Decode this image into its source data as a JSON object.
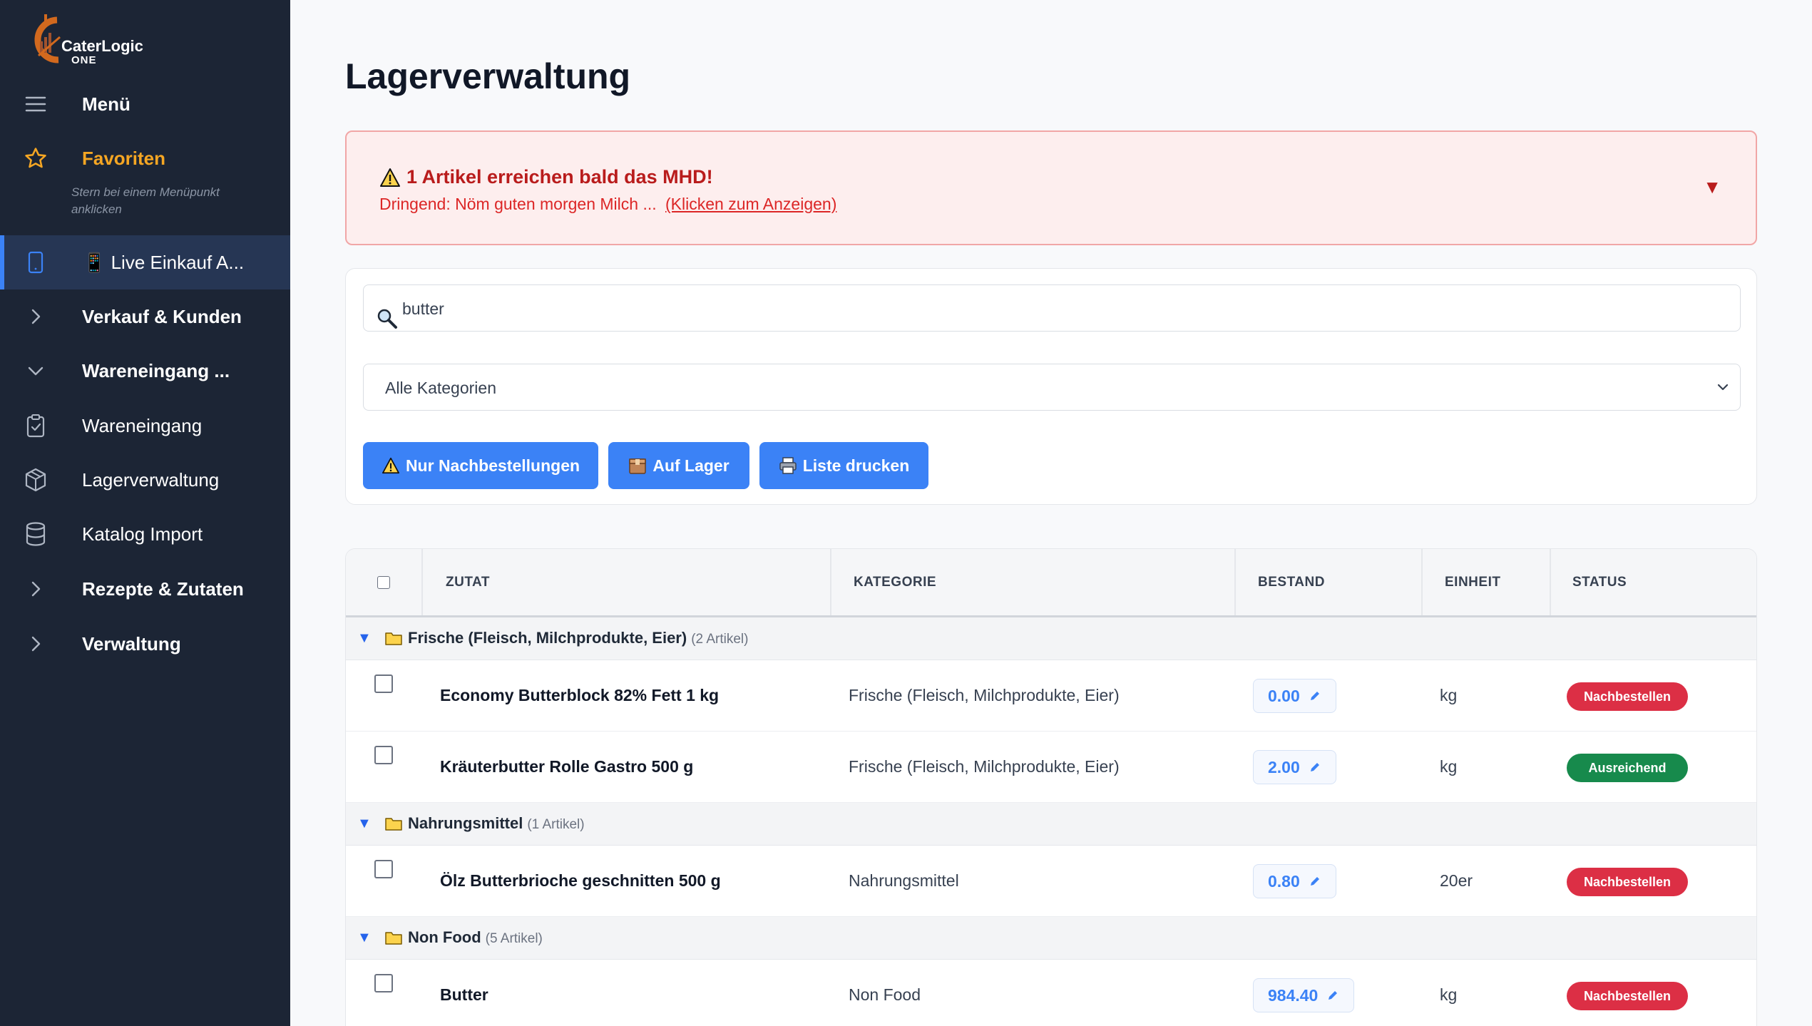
{
  "brand": {
    "logo_name": "CaterLogic",
    "logo_sub": "ONE",
    "accent_color": "#f5a623"
  },
  "sidebar": {
    "menu_label": "Menü",
    "favorites_label": "Favoriten",
    "favorites_hint": "Stern bei einem Menüpunkt anklicken",
    "items": [
      {
        "label": "📱 Live Einkauf A...",
        "icon": "mobile-icon",
        "active": true
      },
      {
        "label": "Verkauf & Kunden",
        "icon": "chevron-right-icon"
      },
      {
        "label": "Wareneingang ...",
        "icon": "chevron-down-icon"
      },
      {
        "label": "Wareneingang",
        "icon": "clipboard-check-icon"
      },
      {
        "label": "Lagerverwaltung",
        "icon": "box-icon"
      },
      {
        "label": "Katalog Import",
        "icon": "database-icon"
      },
      {
        "label": "Rezepte & Zutaten",
        "icon": "chevron-right-icon"
      },
      {
        "label": "Verwaltung",
        "icon": "chevron-right-icon"
      }
    ]
  },
  "page": {
    "title": "Lagerverwaltung"
  },
  "alert": {
    "title": "1 Artikel erreichen bald das MHD!",
    "text": "Dringend: Nöm guten morgen Milch ...",
    "link": "(Klicken zum Anzeigen)",
    "toggle": "▼"
  },
  "filters": {
    "search_value": "butter",
    "category_value": "Alle Kategorien",
    "buttons": {
      "reorder": "Nur Nachbestellungen",
      "in_stock": "Auf Lager",
      "print": "Liste drucken"
    }
  },
  "table": {
    "headers": {
      "ingredient": "ZUTAT",
      "category": "KATEGORIE",
      "stock": "BESTAND",
      "unit": "EINHEIT",
      "status": "STATUS"
    },
    "groups": [
      {
        "name": "Frische (Fleisch, Milchprodukte, Eier)",
        "count": "(2 Artikel)"
      },
      {
        "name": "Nahrungsmittel",
        "count": "(1 Artikel)"
      },
      {
        "name": "Non Food",
        "count": "(5 Artikel)"
      }
    ],
    "rows": [
      {
        "name": "Economy Butterblock 82% Fett 1 kg",
        "category": "Frische (Fleisch, Milchprodukte, Eier)",
        "stock": "0.00",
        "unit": "kg",
        "status": "Nachbestellen"
      },
      {
        "name": "Kräuterbutter Rolle Gastro 500 g",
        "category": "Frische (Fleisch, Milchprodukte, Eier)",
        "stock": "2.00",
        "unit": "kg",
        "status": "Ausreichend"
      },
      {
        "name": "Ölz Butterbrioche geschnitten 500 g",
        "category": "Nahrungsmittel",
        "stock": "0.80",
        "unit": "20er",
        "status": "Nachbestellen"
      },
      {
        "name": "Butter",
        "category": "Non Food",
        "stock": "984.40",
        "unit": "kg",
        "status": "Nachbestellen"
      }
    ],
    "status_colors": {
      "Nachbestellen": "#dc2f45",
      "Ausreichend": "#178a4c"
    }
  }
}
